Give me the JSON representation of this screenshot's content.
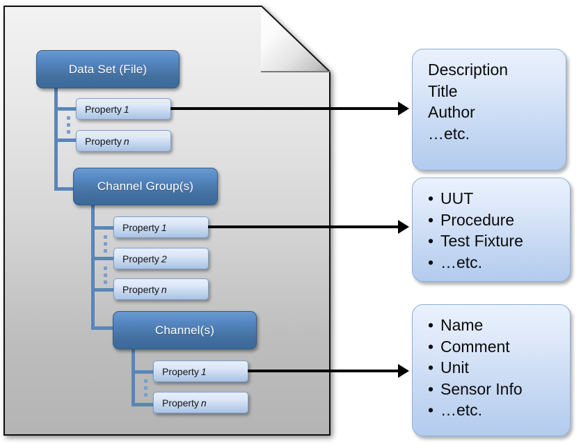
{
  "diagram": {
    "title": "Data Set file hierarchy and property callouts",
    "colors": {
      "node_blue_light": "#6a9ad0",
      "node_blue_dark": "#3c6a98",
      "property_blue_light": "#e7effb",
      "property_blue_dark": "#a9c3e4",
      "connector_blue": "#5a85b8",
      "callout_blue_light": "#e9f1fc",
      "callout_blue_dark": "#b3cbee",
      "arrow_black": "#000000",
      "page_gray_light": "#f2f2f2",
      "page_gray_dark": "#b4b4b4"
    }
  },
  "page": {
    "shape_name": "document-page-with-folded-corner"
  },
  "nodes": {
    "dataset": {
      "label": "Data Set (File)"
    },
    "channel_group": {
      "label": "Channel Group(s)"
    },
    "channel": {
      "label": "Channel(s)"
    }
  },
  "dataset_properties": [
    {
      "label": "Property ",
      "italic": "1"
    },
    {
      "label": "Property ",
      "italic": "n"
    }
  ],
  "channel_group_properties": [
    {
      "label": "Property ",
      "italic": "1"
    },
    {
      "label": "Property ",
      "italic": "2"
    },
    {
      "label": "Property ",
      "italic": "n"
    }
  ],
  "channel_properties": [
    {
      "label": "Property ",
      "italic": "1"
    },
    {
      "label": "Property ",
      "italic": "n"
    }
  ],
  "callouts": [
    {
      "name": "dataset-property-callout",
      "bulleted": false,
      "lines": [
        "Description",
        "Title",
        "Author",
        "…etc."
      ]
    },
    {
      "name": "channel-group-property-callout",
      "bulleted": true,
      "lines": [
        "UUT",
        "Procedure",
        "Test Fixture",
        "…etc."
      ]
    },
    {
      "name": "channel-property-callout",
      "bulleted": true,
      "lines": [
        "Name",
        "Comment",
        "Unit",
        "Sensor Info",
        "…etc."
      ]
    }
  ],
  "arrows": [
    {
      "name": "arrow-dataset-property-to-callout"
    },
    {
      "name": "arrow-channel-group-property-to-callout"
    },
    {
      "name": "arrow-channel-property-to-callout"
    }
  ]
}
